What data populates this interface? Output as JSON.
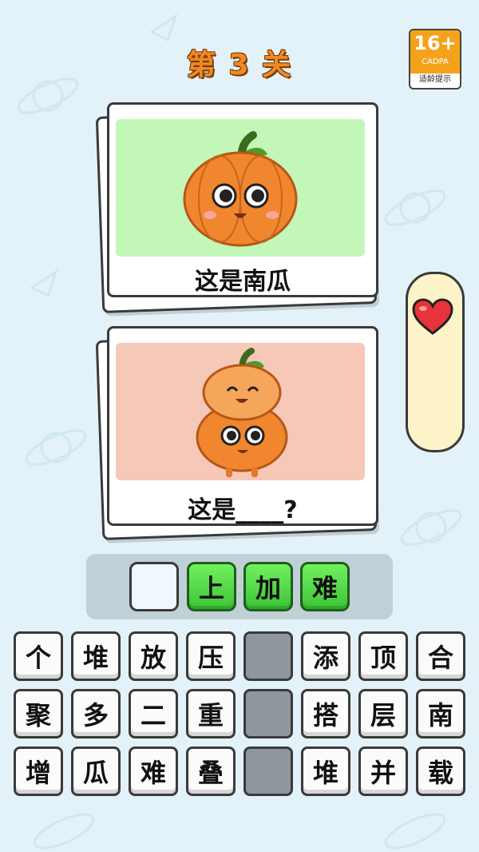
{
  "header": {
    "level_title": "第 3 关"
  },
  "age_rating": {
    "rating": "16+",
    "organization": "CADPA",
    "tip": "适龄提示"
  },
  "cards": [
    {
      "caption": "这是南瓜",
      "picture": "smiling-pumpkin",
      "picture_bg": "#c2f7b8"
    },
    {
      "caption": "这是____?",
      "picture": "stacked-pumpkins",
      "picture_bg": "#f6c8b7"
    }
  ],
  "sidebar": {
    "icon": "heart-icon"
  },
  "answer": {
    "slots": [
      "",
      "上",
      "加",
      "难"
    ]
  },
  "tiles": {
    "rows": [
      [
        "个",
        "堆",
        "放",
        "压",
        "",
        "添",
        "顶",
        "合"
      ],
      [
        "聚",
        "多",
        "二",
        "重",
        "",
        "搭",
        "层",
        "南"
      ],
      [
        "增",
        "瓜",
        "难",
        "叠",
        "",
        "堆",
        "并",
        "载"
      ]
    ]
  },
  "colors": {
    "background": "#e3f2f8",
    "title_orange": "#f08a24",
    "answer_green": "#4cd43f",
    "used_tile": "#8e979d"
  }
}
